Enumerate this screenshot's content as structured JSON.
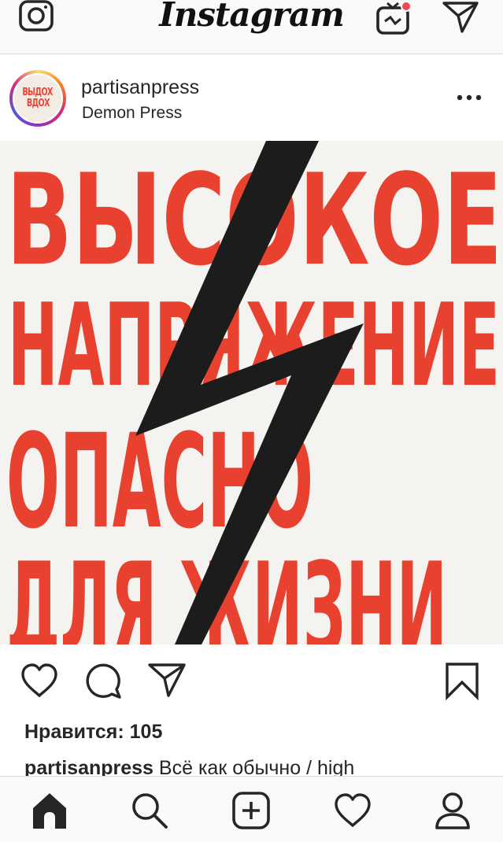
{
  "app": {
    "title": "Instagram"
  },
  "top_bar": {
    "icons": [
      "camera-icon",
      "igtv-icon",
      "direct-message-icon"
    ],
    "notification_dot_color": "#ed4956"
  },
  "post": {
    "username": "partisanpress",
    "location": "Demon Press",
    "avatar_text": [
      "ВЫДОХ",
      "ВДОХ"
    ],
    "image": {
      "poster_lines": [
        "ВЫСОКОЕ",
        "НАПРЯЖЕНИЕ",
        "ОПАСНО",
        "ДЛЯ ЖИЗНИ"
      ],
      "ink_color": "#e8412f",
      "bolt_color": "#1c1c1c"
    },
    "likes_text": "Нравится: 105",
    "caption_user": "partisanpress",
    "caption_text": "Всё как обычно / high"
  },
  "bottom_nav": {
    "items": [
      "home-icon",
      "search-icon",
      "new-post-icon",
      "activity-icon",
      "profile-icon"
    ]
  }
}
